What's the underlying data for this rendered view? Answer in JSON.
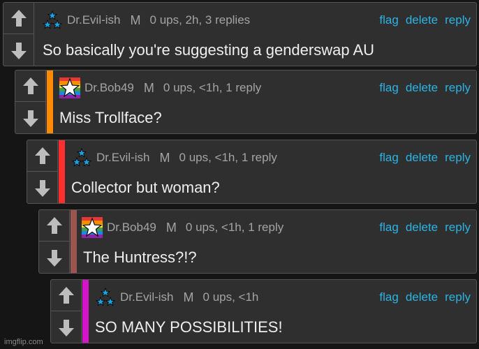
{
  "comments": [
    {
      "username": "Dr.Evil-ish",
      "gender": "M",
      "stats": "0 ups, 2h, 3 replies",
      "text": "So basically you're suggesting a genderswap AU",
      "flag": "flag",
      "delete": "delete",
      "reply": "reply",
      "stripe_color": "",
      "avatar": "blue-stars-icon"
    },
    {
      "username": "Dr.Bob49",
      "gender": "M",
      "stats": "0 ups, <1h, 1 reply",
      "text": "Miss Trollface?",
      "flag": "flag",
      "delete": "delete",
      "reply": "reply",
      "stripe_color": "#ff8a00",
      "avatar": "rainbow-star-icon"
    },
    {
      "username": "Dr.Evil-ish",
      "gender": "M",
      "stats": "0 ups, <1h, 1 reply",
      "text": "Collector but woman?",
      "flag": "flag",
      "delete": "delete",
      "reply": "reply",
      "stripe_color": "#ff2f2f",
      "avatar": "blue-stars-icon"
    },
    {
      "username": "Dr.Bob49",
      "gender": "M",
      "stats": "0 ups, <1h, 1 reply",
      "text": "The Huntress?!?",
      "flag": "flag",
      "delete": "delete",
      "reply": "reply",
      "stripe_color": "#9a5550",
      "avatar": "rainbow-star-icon"
    },
    {
      "username": "Dr.Evil-ish",
      "gender": "M",
      "stats": "0 ups, <1h",
      "text": "SO MANY POSSIBILITIES!",
      "flag": "flag",
      "delete": "delete",
      "reply": "reply",
      "stripe_color": "#d416c8",
      "avatar": "blue-stars-icon"
    }
  ],
  "watermark": "imgflip.com",
  "colors": {
    "background": "#151515",
    "panel": "#2f2f2f",
    "action_link": "#2ab4e6",
    "meta_text": "#a4a4a4",
    "body_text": "#eeeeee"
  }
}
